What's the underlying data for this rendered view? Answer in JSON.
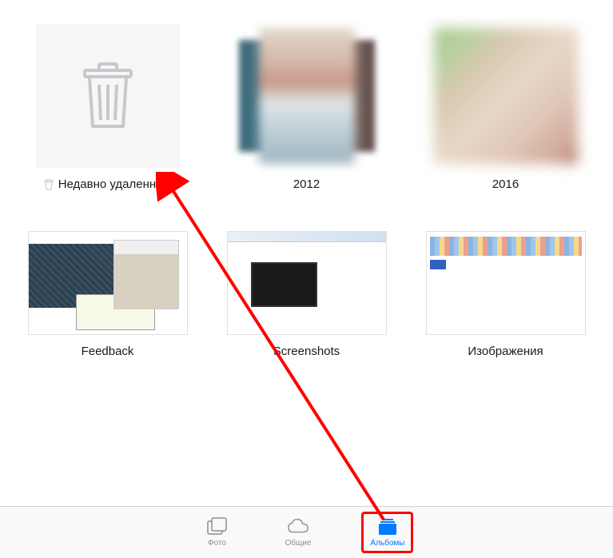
{
  "albums": [
    {
      "id": "recently-deleted",
      "label": "Недавно удаленные",
      "has_trash_icon": true
    },
    {
      "id": "2012",
      "label": "2012"
    },
    {
      "id": "2016",
      "label": "2016"
    },
    {
      "id": "feedback",
      "label": "Feedback"
    },
    {
      "id": "screenshots",
      "label": "Screenshots"
    },
    {
      "id": "images",
      "label": "Изображения"
    }
  ],
  "tabs": {
    "photos": {
      "label": "Фото"
    },
    "shared": {
      "label": "Общие"
    },
    "albums": {
      "label": "Альбомы"
    }
  },
  "colors": {
    "active_tab": "#007aff",
    "inactive_tab": "#8e8e93",
    "annotation": "#ff0000"
  }
}
